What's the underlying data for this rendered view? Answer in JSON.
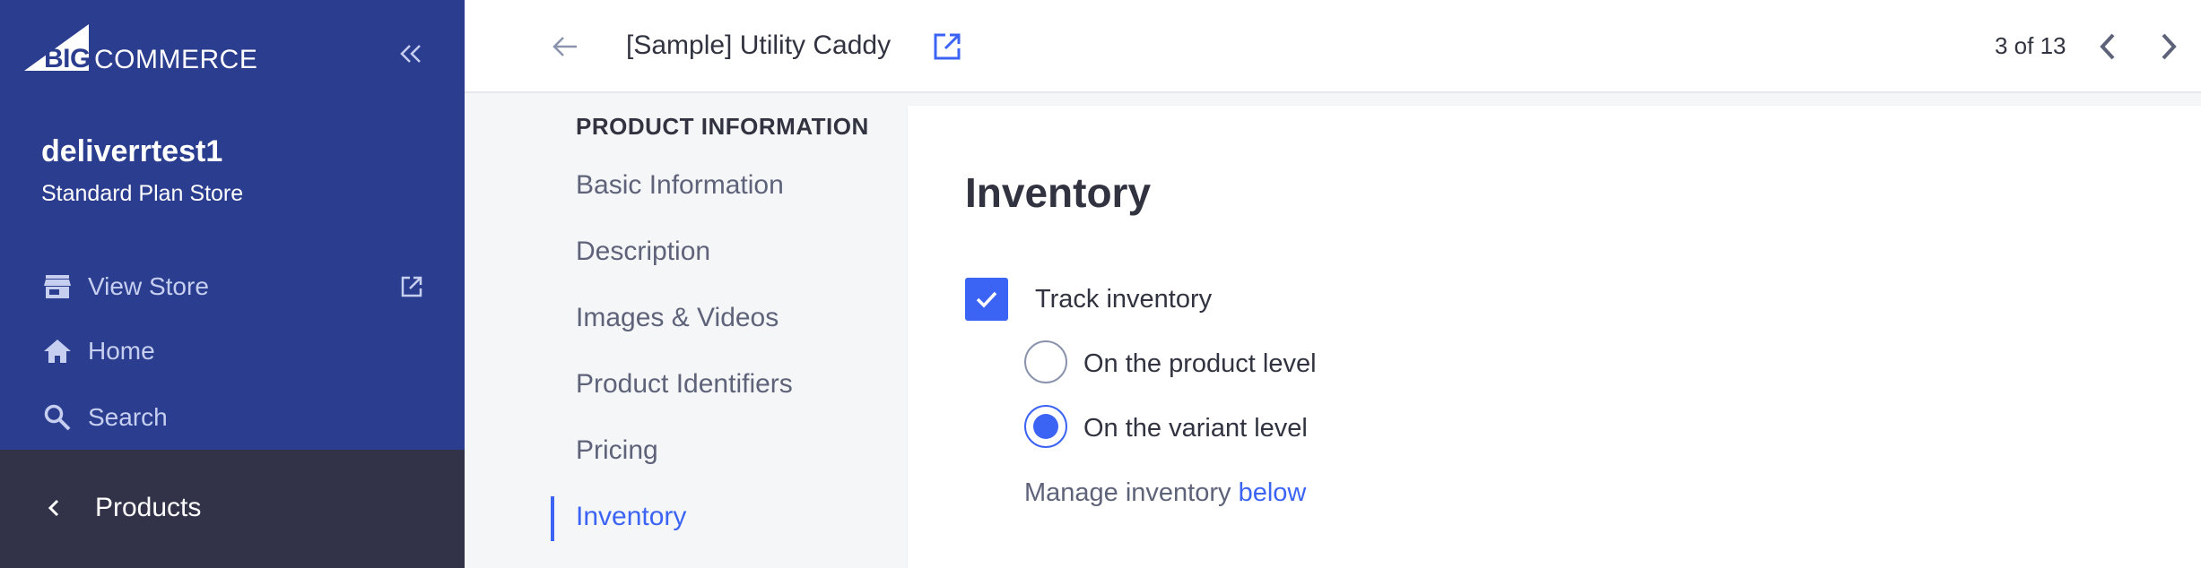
{
  "brand": {
    "logo_big": "BIG",
    "logo_commerce": "COMMERCE"
  },
  "sidebar": {
    "store_name": "deliverrtest1",
    "store_plan": "Standard Plan Store",
    "nav": [
      {
        "label": "View Store",
        "icon": "storefront-icon"
      },
      {
        "label": "Home",
        "icon": "home-icon"
      },
      {
        "label": "Search",
        "icon": "search-icon"
      }
    ],
    "section_label": "Products"
  },
  "header": {
    "product_title": "[Sample] Utility Caddy",
    "pager": "3 of 13"
  },
  "subnav": {
    "heading": "PRODUCT INFORMATION",
    "items": [
      {
        "label": "Basic Information"
      },
      {
        "label": "Description"
      },
      {
        "label": "Images & Videos"
      },
      {
        "label": "Product Identifiers"
      },
      {
        "label": "Pricing"
      },
      {
        "label": "Inventory"
      }
    ],
    "active_index": 5
  },
  "inventory": {
    "title": "Inventory",
    "track_label": "Track inventory",
    "track_checked": true,
    "option_product": "On the product level",
    "option_variant": "On the variant level",
    "selected": "variant",
    "manage_prefix": "Manage inventory",
    "manage_link": "below"
  },
  "colors": {
    "sidebar_bg": "#2b3d8f",
    "sidebar_section_bg": "#323349",
    "accent": "#3c64f4",
    "text": "#313440",
    "muted": "#5e637a"
  }
}
